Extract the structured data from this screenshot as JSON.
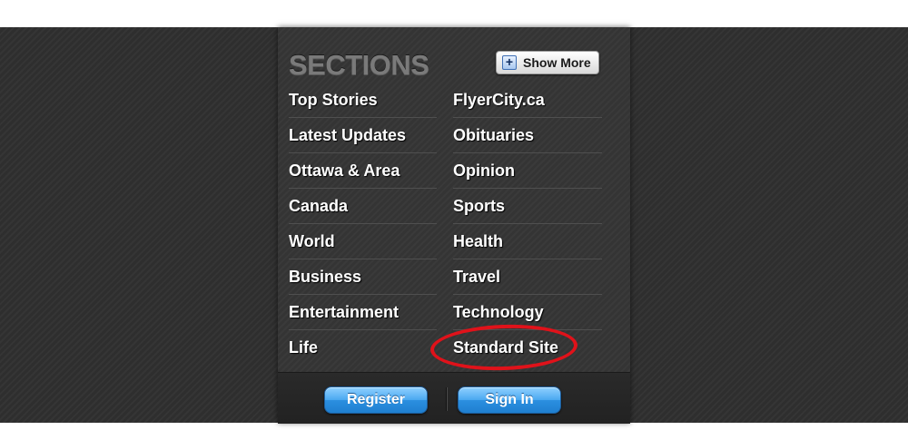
{
  "header": {
    "title": "SECTIONS",
    "show_more_label": "Show More",
    "show_more_icon": "plus-icon"
  },
  "sections": {
    "left": [
      "Top Stories",
      "Latest Updates",
      "Ottawa & Area",
      "Canada",
      "World",
      "Business",
      "Entertainment",
      "Life"
    ],
    "right": [
      "FlyerCity.ca",
      "Obituaries",
      "Opinion",
      "Sports",
      "Health",
      "Travel",
      "Technology",
      "Standard Site"
    ]
  },
  "highlight": {
    "target": "Standard Site",
    "color": "#e0121a"
  },
  "footer": {
    "register_label": "Register",
    "signin_label": "Sign In"
  },
  "colors": {
    "button_blue": "#2b8fe0",
    "panel_bg": "#343434",
    "title_gray": "#7a7a7a"
  }
}
